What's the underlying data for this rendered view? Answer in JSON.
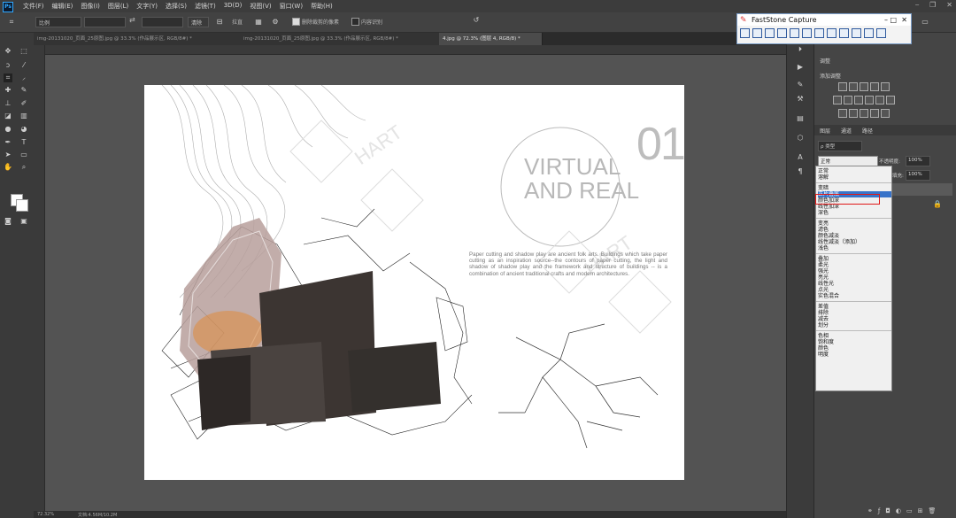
{
  "menu": {
    "logo": "Ps",
    "items": [
      "文件(F)",
      "编辑(E)",
      "图像(I)",
      "图层(L)",
      "文字(Y)",
      "选择(S)",
      "滤镜(T)",
      "3D(D)",
      "视图(V)",
      "窗口(W)",
      "帮助(H)"
    ],
    "window_controls": [
      "⎯",
      "❐",
      "✕"
    ]
  },
  "options": {
    "ratio_label": "比例",
    "swap_icon": "⇄",
    "clear_label": "清除",
    "straighten_label": "拉直",
    "delete_cropped_label": "删除裁剪的像素",
    "content_aware_label": "内容识别"
  },
  "tabs": [
    {
      "label": "img-20131020_页面_25原图.jpg @ 33.3% (作品展示区, RGB/8#) *",
      "active": false
    },
    {
      "label": "img-20131020_页面_25原图.jpg @ 33.3% (作品展示区, RGB/8#) *",
      "active": false
    },
    {
      "label": "4.jpg @ 72.3% (图层 4, RGB/8) *",
      "active": true
    }
  ],
  "artwork": {
    "number": "01",
    "title_line1": "VIRTUAL",
    "title_line2": "AND REAL",
    "watermark": "HART",
    "paragraph": "Paper cutting and shadow play are ancient folk arts. Buildings which take paper cutting as an inspiration source--the contours of paper cutting, the light and shadow of shadow play and the framework and structure of buildings -- is a combination of ancient traditional crafts and modern architectures."
  },
  "status": {
    "zoom": "72.32%",
    "doc": "文档:4.56M/10.2M"
  },
  "panels": {
    "adjust_tab": "调整",
    "add_adjust": "添加调整",
    "layers_tab": "图层",
    "channels_tab": "通道",
    "paths_tab": "路径",
    "kind_label": "ρ 类型",
    "blend_mode": "正常",
    "opacity_label": "不透明度:",
    "opacity_value": "100%",
    "fill_label": "填充:",
    "fill_value": "100%"
  },
  "blend_menu": {
    "groups": [
      [
        "正常",
        "溶解"
      ],
      [
        "变暗",
        "正片叠底",
        "颜色加深",
        "线性加深",
        "深色"
      ],
      [
        "变亮",
        "滤色",
        "颜色减淡",
        "线性减淡（添加）",
        "浅色"
      ],
      [
        "叠加",
        "柔光",
        "强光",
        "亮光",
        "线性光",
        "点光",
        "实色混合"
      ],
      [
        "差值",
        "排除",
        "减去",
        "划分"
      ],
      [
        "色相",
        "饱和度",
        "颜色",
        "明度"
      ]
    ],
    "highlighted": "正片叠底"
  },
  "faststone": {
    "title": "FastStone Capture",
    "controls": [
      "–",
      "□",
      "✕"
    ]
  }
}
